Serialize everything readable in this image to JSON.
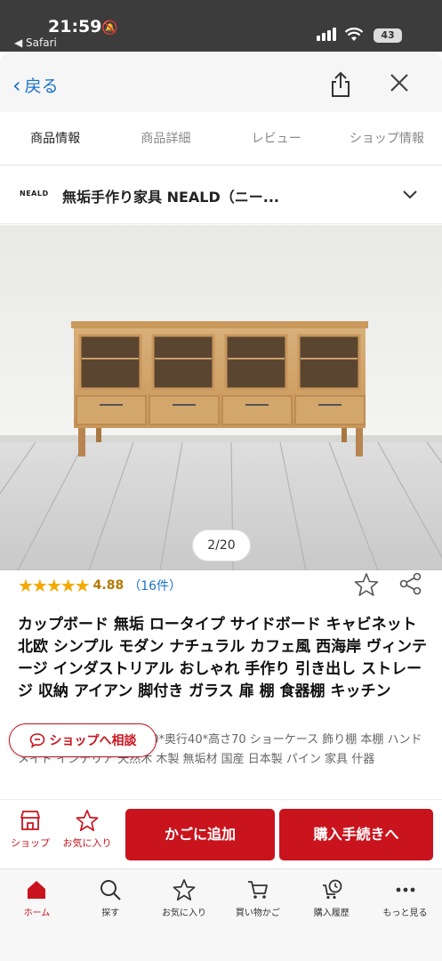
{
  "status": {
    "time": "21:59",
    "back_app": "◀ Safari",
    "battery": "43"
  },
  "nav": {
    "back_label": "戻る"
  },
  "tabs": [
    {
      "label": "商品情報",
      "active": true
    },
    {
      "label": "商品詳細",
      "active": false
    },
    {
      "label": "レビュー",
      "active": false
    },
    {
      "label": "ショップ情報",
      "active": false
    }
  ],
  "shop": {
    "logo_text": "NEALD",
    "name": "無垢手作り家具 NEALD（ニー..."
  },
  "gallery": {
    "counter": "2/20"
  },
  "rating": {
    "stars": "★★★★★",
    "score": "4.88",
    "count": "（16件）",
    "value": 4.88,
    "max": 5
  },
  "product": {
    "title": "カップボード 無垢 ロータイプ サイドボード キャビネット 北欧 シンプル モダン ナチュラル カフェ風 西海岸 ヴィンテージ インダストリアル おしゃれ 手作り 引き出し ストレージ 収納 アイアン 脚付き ガラス 扉 棚 食器棚 キッチン",
    "description": "【サイズオーダー 】幅150*奥行40*高さ70 ショーケース 飾り棚 本棚 ハンドメイド インテリア 天然木 木製 無垢材 国産 日本製 パイン 家具 什器"
  },
  "consult_button": "ショップへ相談",
  "actions": {
    "shop_label": "ショップ",
    "favorite_label": "お気に入り",
    "cart_button": "かごに追加",
    "buy_button": "購入手続きへ"
  },
  "tabbar": [
    {
      "label": "ホーム",
      "icon": "home-icon",
      "active": true
    },
    {
      "label": "探す",
      "icon": "search-icon",
      "active": false
    },
    {
      "label": "お気に入り",
      "icon": "star-icon",
      "active": false
    },
    {
      "label": "買い物かご",
      "icon": "cart-icon",
      "active": false
    },
    {
      "label": "購入履歴",
      "icon": "history-icon",
      "active": false
    },
    {
      "label": "もっと見る",
      "icon": "more-icon",
      "active": false
    }
  ],
  "colors": {
    "brand_red": "#c9141e",
    "link_blue": "#1a73c8",
    "star_gold": "#f5a800"
  }
}
